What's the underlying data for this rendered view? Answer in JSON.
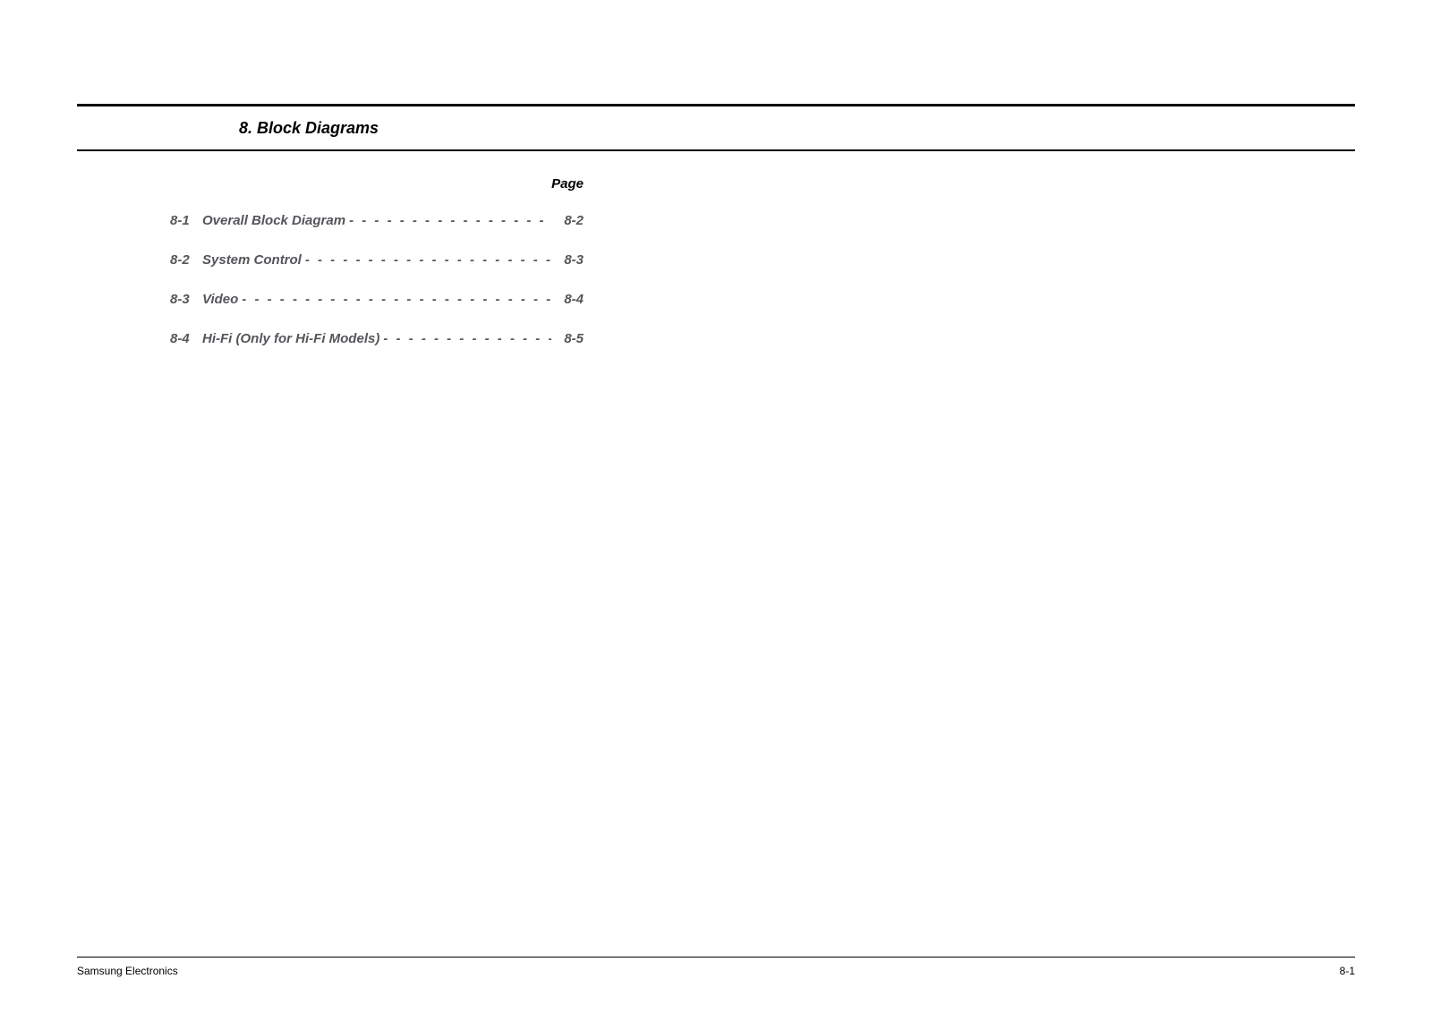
{
  "chapter": {
    "number": "8",
    "title": "8. Block Diagrams"
  },
  "page_label": "Page",
  "toc": [
    {
      "num": "8-1",
      "label": "Overall Block Diagram",
      "page": "8-2"
    },
    {
      "num": "8-2",
      "label": "System Control",
      "page": "8-3"
    },
    {
      "num": "8-3",
      "label": "Video",
      "page": "8-4"
    },
    {
      "num": "8-4",
      "label": "Hi-Fi (Only for Hi-Fi Models)",
      "page": "8-5"
    }
  ],
  "leader_fill": "- - - - - - - - - - - - - - - - - - - - - - - - - - - - - - - - - - - - - - - - - - - - - - - -",
  "footer": {
    "left": "Samsung Electronics",
    "right": "8-1"
  }
}
